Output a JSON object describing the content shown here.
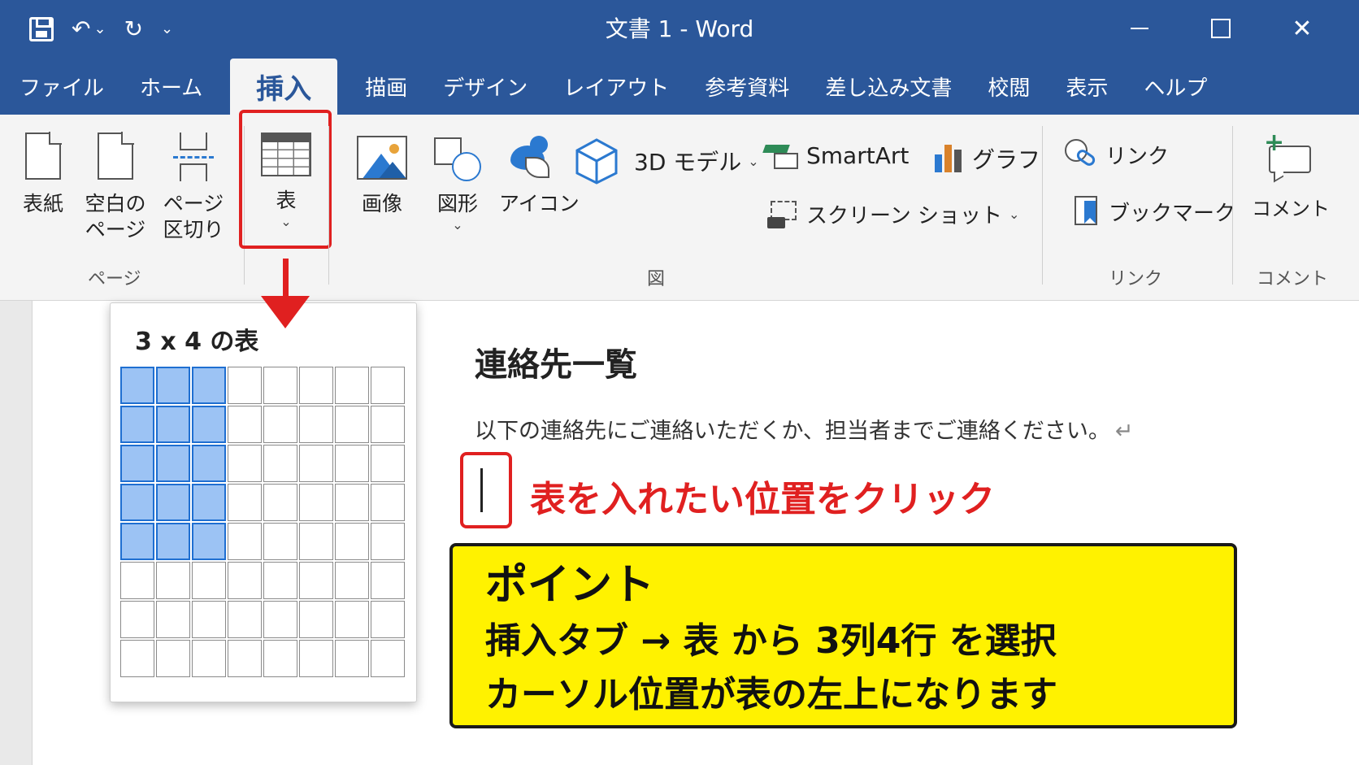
{
  "window": {
    "title": "文書 1  -  Word",
    "minimize": "",
    "maximize": "",
    "close": "✕"
  },
  "qat": {
    "undo": "↶",
    "redo": "↻",
    "dropdown": "⌄"
  },
  "tabs": [
    {
      "label": "ファイル",
      "active": false
    },
    {
      "label": "ホーム",
      "active": false
    },
    {
      "label": "挿入",
      "active": true
    },
    {
      "label": "描画",
      "active": false
    },
    {
      "label": "デザイン",
      "active": false
    },
    {
      "label": "レイアウト",
      "active": false
    },
    {
      "label": "参考資料",
      "active": false
    },
    {
      "label": "差し込み文書",
      "active": false
    },
    {
      "label": "校閲",
      "active": false
    },
    {
      "label": "表示",
      "active": false
    },
    {
      "label": "ヘルプ",
      "active": false
    }
  ],
  "ribbon": {
    "pages": {
      "group_label": "ページ",
      "cover": "表紙",
      "blank_line1": "空白の",
      "blank_line2": "ページ",
      "break_line1": "ページ",
      "break_line2": "区切り"
    },
    "table": {
      "label": "表",
      "chevron": "⌄"
    },
    "illustrations": {
      "group_label": "図",
      "picture": "画像",
      "shapes": "図形",
      "shapes_chevron": "⌄",
      "icons": "アイコン",
      "model3d": "3D モデル",
      "smartart": "SmartArt",
      "chart": "グラフ",
      "screenshot": "スクリーン ショット",
      "chevron": "⌄"
    },
    "links": {
      "group_label": "リンク",
      "link": "リンク",
      "bookmark": "ブックマーク"
    },
    "comments": {
      "group_label": "コメント",
      "comment": "コメント",
      "plus": "+"
    }
  },
  "table_popup": {
    "title": "3 x 4 の表",
    "grid_columns": 8,
    "grid_rows": 8,
    "selected_columns": 3,
    "selected_rows": 5
  },
  "document": {
    "heading": "連絡先一覧",
    "paragraph": "以下の連絡先にご連絡いただくか、担当者までご連絡ください。",
    "return_mark": "↵"
  },
  "annotation": {
    "click_note": "表を入れたい位置をクリック",
    "point_title": "ポイント",
    "point_line1": "挿入タブ → 表 から 3列4行 を選択",
    "point_line2": "カーソル位置が表の左上になります"
  },
  "colors": {
    "word_blue": "#2b579a",
    "highlight_red": "#e02020",
    "point_yellow": "#fff200",
    "grid_selected": "#9cc3f4",
    "icon_blue": "#2b79d0"
  }
}
